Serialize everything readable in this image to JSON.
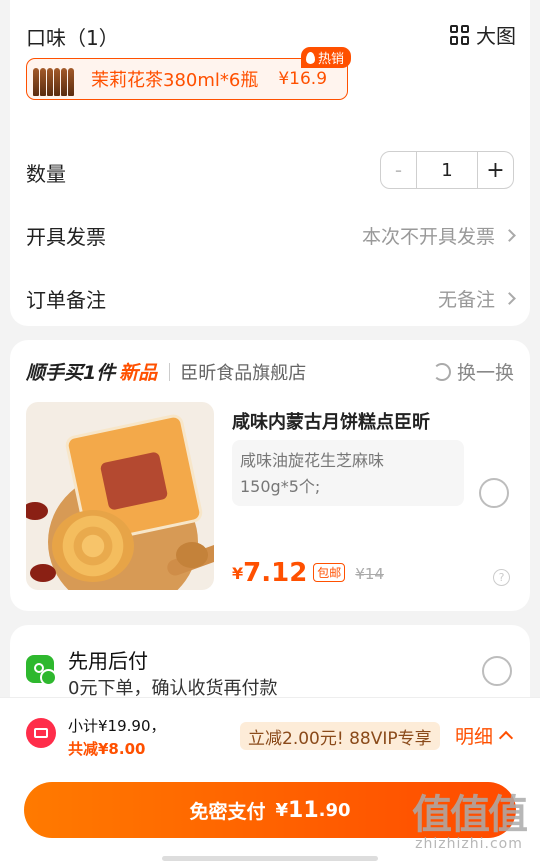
{
  "options": {
    "flavor_title": "口味（1）",
    "big_view_label": "大图",
    "sku": {
      "name": "茉莉花茶380ml*6瓶",
      "price": "¥16.9",
      "badge": "热销"
    }
  },
  "quantity": {
    "label": "数量",
    "minus": "-",
    "value": "1",
    "plus": "+"
  },
  "invoice": {
    "label": "开具发票",
    "value": "本次不开具发票"
  },
  "remark": {
    "label": "订单备注",
    "value": "无备注"
  },
  "addon": {
    "title": "顺手买1件",
    "title_new": "新品",
    "store": "臣昕食品旗舰店",
    "swap_label": "换一换",
    "product": {
      "name": "咸味内蒙古月饼糕点臣昕",
      "spec_line1": "咸味油旋花生芝麻味",
      "spec_line2": "150g*5个;",
      "currency": "¥",
      "price": "7.12",
      "free_shipping": "包邮",
      "original_price": "¥14"
    }
  },
  "pay_later": {
    "title": "先用后付",
    "subtitle": "0元下单，确认收货再付款"
  },
  "summary": {
    "subtotal": "小计¥19.90，",
    "reduction": "共减¥8.00",
    "vip_promo": "立减2.00元! 88VIP专享",
    "detail_label": "明细"
  },
  "pay_button": {
    "label": "免密支付",
    "currency": "¥",
    "amount_int": "11",
    "amount_dec": ".90"
  },
  "watermark": {
    "big": "值值值",
    "small": "zhizhizhi.com"
  },
  "colors": {
    "accent": "#ff5000",
    "green": "#2eb82e",
    "coupon_red": "#ff2d4a"
  }
}
